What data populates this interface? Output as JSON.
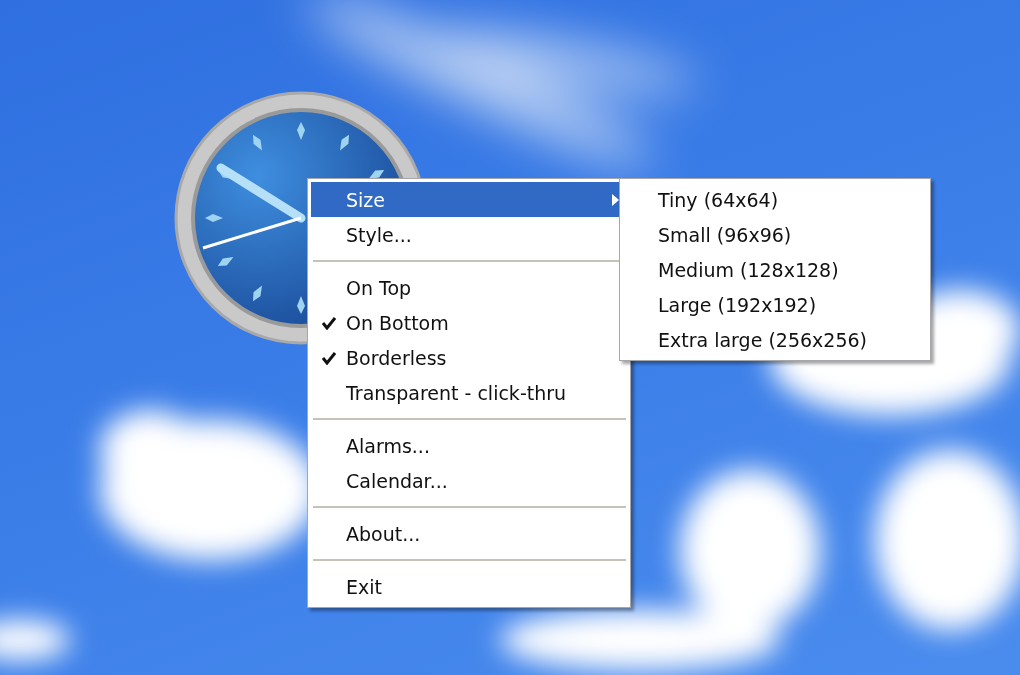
{
  "menu": {
    "items": [
      {
        "kind": "item",
        "label": "Size",
        "checked": false,
        "selected": true,
        "submenu": true
      },
      {
        "kind": "item",
        "label": "Style...",
        "checked": false,
        "selected": false,
        "submenu": false
      },
      {
        "kind": "separator"
      },
      {
        "kind": "item",
        "label": "On Top",
        "checked": false,
        "selected": false,
        "submenu": false
      },
      {
        "kind": "item",
        "label": "On Bottom",
        "checked": true,
        "selected": false,
        "submenu": false
      },
      {
        "kind": "item",
        "label": "Borderless",
        "checked": true,
        "selected": false,
        "submenu": false
      },
      {
        "kind": "item",
        "label": "Transparent - click-thru",
        "checked": false,
        "selected": false,
        "submenu": false
      },
      {
        "kind": "separator"
      },
      {
        "kind": "item",
        "label": "Alarms...",
        "checked": false,
        "selected": false,
        "submenu": false
      },
      {
        "kind": "item",
        "label": "Calendar...",
        "checked": false,
        "selected": false,
        "submenu": false
      },
      {
        "kind": "separator"
      },
      {
        "kind": "item",
        "label": "About...",
        "checked": false,
        "selected": false,
        "submenu": false
      },
      {
        "kind": "separator"
      },
      {
        "kind": "item",
        "label": "Exit",
        "checked": false,
        "selected": false,
        "submenu": false
      }
    ]
  },
  "submenu": {
    "items": [
      {
        "label": "Tiny (64x64)",
        "selected": false
      },
      {
        "label": "Small (96x96)",
        "selected": false
      },
      {
        "label": "Medium (128x128)",
        "selected": false
      },
      {
        "label": "Large (192x192)",
        "selected": false
      },
      {
        "label": "Extra large (256x256)",
        "selected": false
      }
    ]
  }
}
